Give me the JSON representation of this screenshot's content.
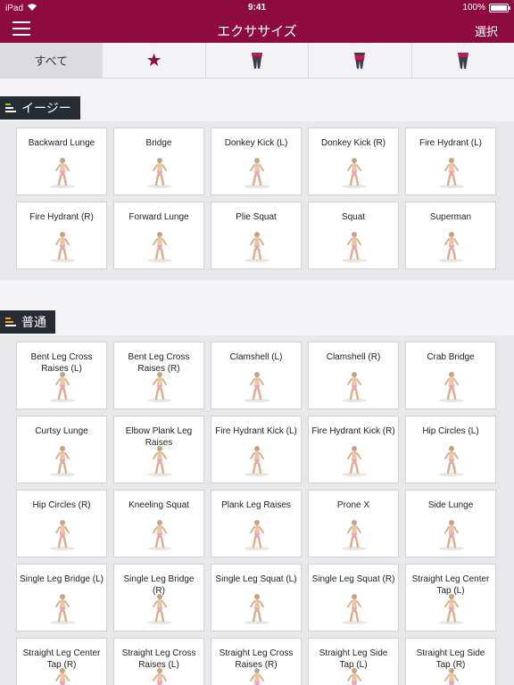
{
  "status": {
    "device": "iPad",
    "time": "9:41",
    "battery": "100%"
  },
  "nav": {
    "title": "エクササイズ",
    "select_label": "選択"
  },
  "tabs": [
    {
      "label": "すべて",
      "icon": ""
    },
    {
      "label": "",
      "icon": "star-icon"
    },
    {
      "label": "",
      "icon": "leg-icon"
    },
    {
      "label": "",
      "icon": "glute-icon"
    },
    {
      "label": "",
      "icon": "hip-icon"
    }
  ],
  "colors": {
    "brand": "#8e0b3f",
    "section_label_bg": "#262b34",
    "level_easy": "#7ed321",
    "level_normal": "#f5a623"
  },
  "sections": [
    {
      "label": "イージー",
      "level": 1,
      "exercises": [
        "Backward Lunge",
        "Bridge",
        "Donkey Kick (L)",
        "Donkey Kick (R)",
        "Fire Hydrant (L)",
        "Fire Hydrant (R)",
        "Forward Lunge",
        "Plie Squat",
        "Squat",
        "Superman"
      ]
    },
    {
      "label": "普通",
      "level": 2,
      "exercises": [
        "Bent Leg Cross Raises (L)",
        "Bent Leg Cross Raises (R)",
        "Clamshell (L)",
        "Clamshell (R)",
        "Crab Bridge",
        "Curtsy Lunge",
        "Elbow Plank Leg Raises",
        "Fire Hydrant Kick (L)",
        "Fire Hydrant Kick (R)",
        "Hip Circles (L)",
        "Hip Circles (R)",
        "Kneeling Squat",
        "Plank Leg Raises",
        "Prone X",
        "Side Lunge",
        "Single Leg Bridge (L)",
        "Single Leg Bridge (R)",
        "Single Leg Squat (L)",
        "Single Leg Squat (R)",
        "Straight Leg Center Tap (L)",
        "Straight Leg Center Tap (R)",
        "Straight Leg Cross Raises (L)",
        "Straight Leg Cross Raises (R)",
        "Straight Leg Side Tap (L)",
        "Straight Leg Side Tap (R)"
      ]
    }
  ]
}
